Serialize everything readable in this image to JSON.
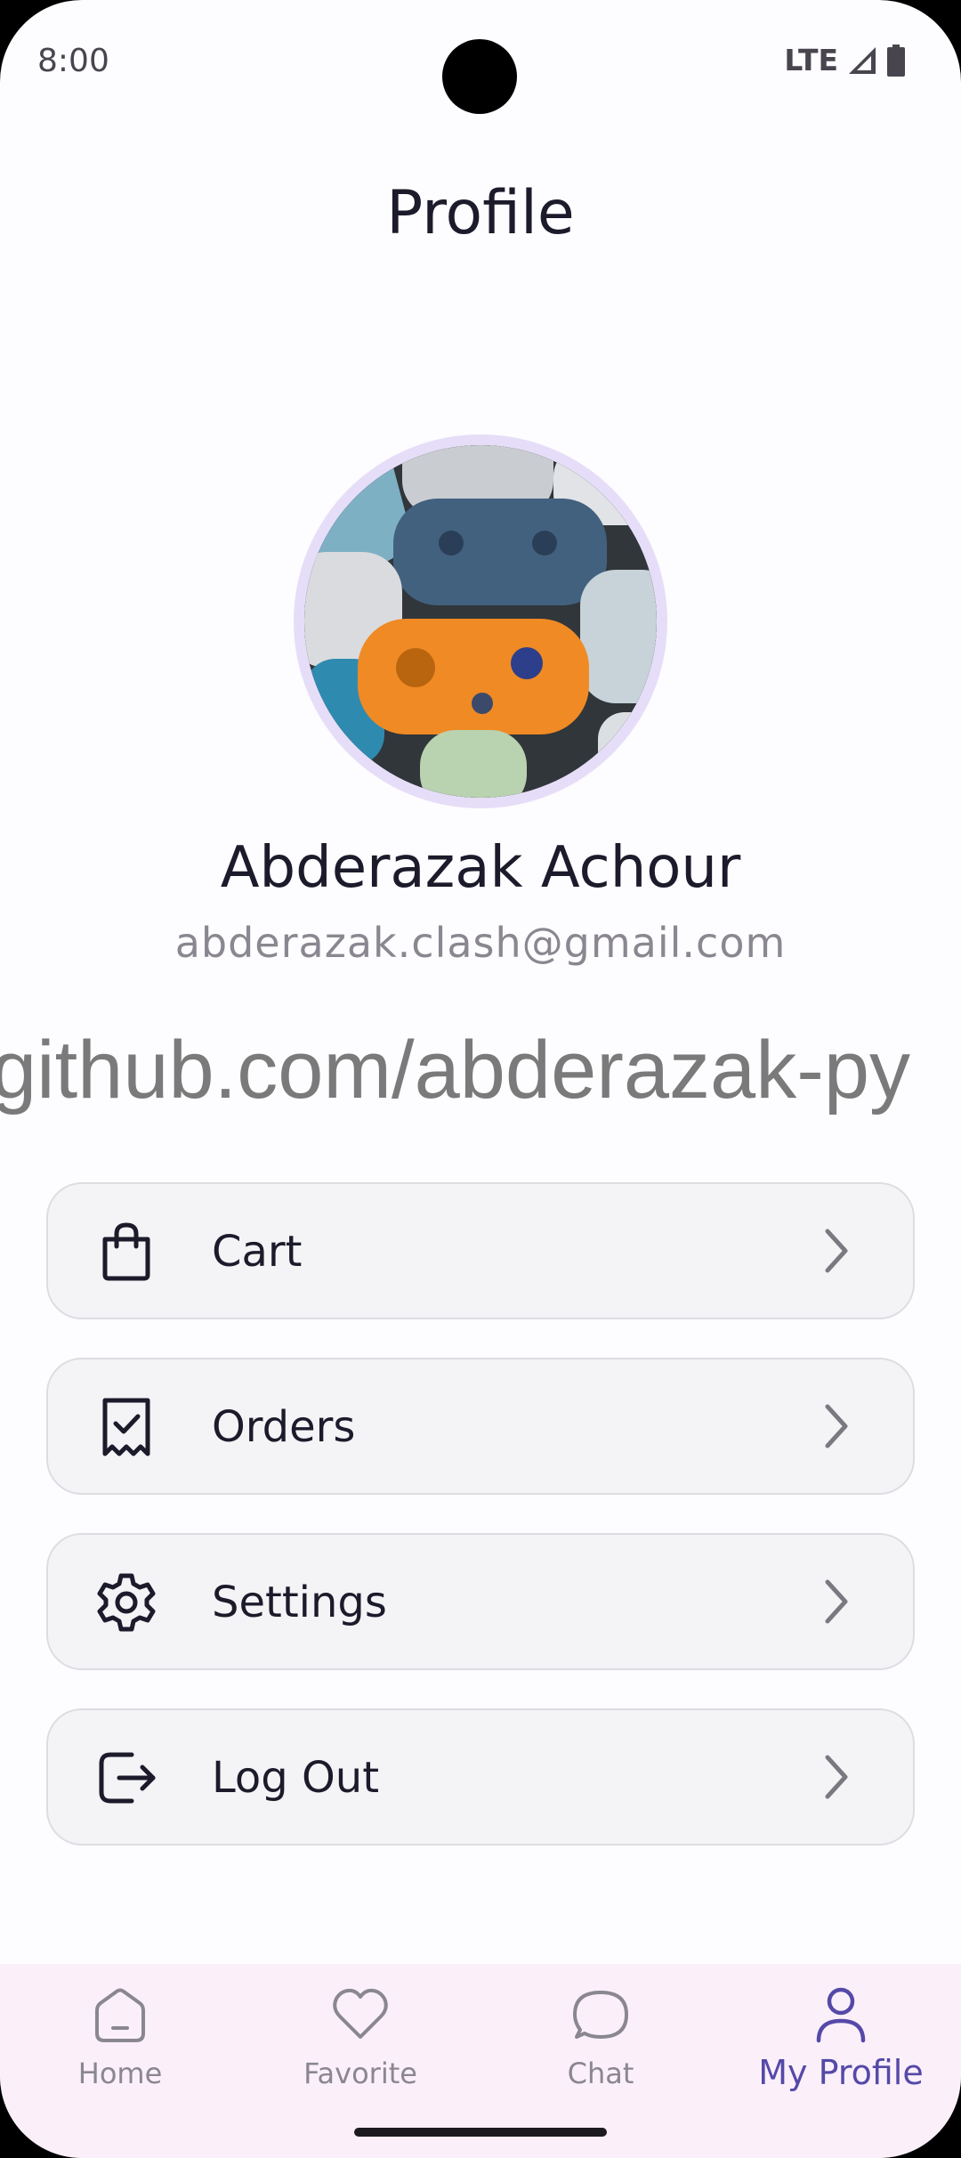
{
  "status_bar": {
    "time": "8:00",
    "network": "LTE"
  },
  "header": {
    "title": "Profile"
  },
  "profile": {
    "name": "Abderazak Achour",
    "email": "abderazak.clash@gmail.com"
  },
  "watermark": "github.com/abderazak-py",
  "menu": {
    "items": [
      {
        "label": "Cart",
        "icon": "shopping-bag-icon"
      },
      {
        "label": "Orders",
        "icon": "receipt-check-icon"
      },
      {
        "label": "Settings",
        "icon": "gear-icon"
      },
      {
        "label": "Log Out",
        "icon": "logout-icon"
      }
    ]
  },
  "bottom_nav": {
    "items": [
      {
        "label": "Home",
        "icon": "home-icon",
        "active": false
      },
      {
        "label": "Favorite",
        "icon": "heart-icon",
        "active": false
      },
      {
        "label": "Chat",
        "icon": "chat-bubble-icon",
        "active": false
      },
      {
        "label": "My Profile",
        "icon": "person-icon",
        "active": true
      }
    ]
  },
  "colors": {
    "accent": "#5549a8",
    "text_primary": "#1c1b2b",
    "text_secondary": "#8a8790",
    "nav_background": "#fbf0fa",
    "avatar_ring": "#e6def8"
  }
}
